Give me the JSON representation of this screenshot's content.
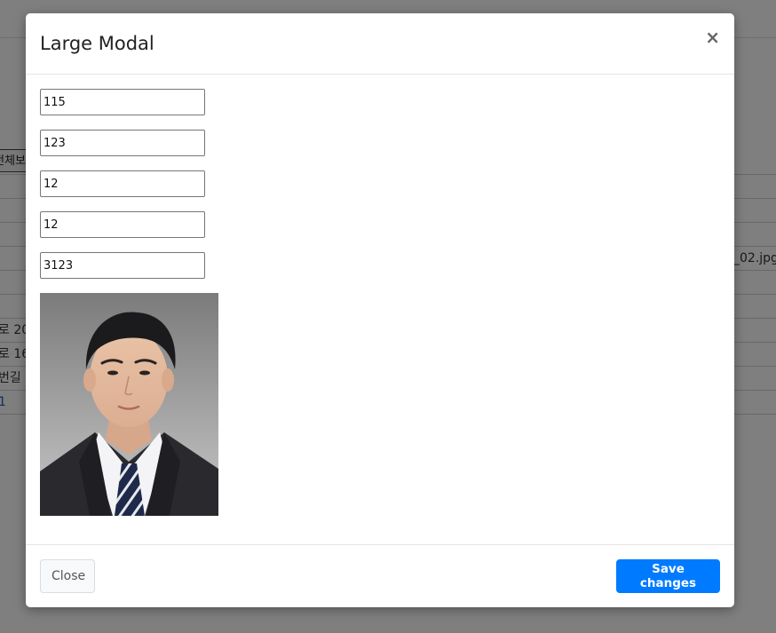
{
  "background": {
    "all_button_label": "전체보",
    "rows": [
      {
        "left": "",
        "right": ""
      },
      {
        "left": "",
        "right": ""
      },
      {
        "left": "",
        "right": ""
      },
      {
        "left": "",
        "right": "_02.jpg"
      },
      {
        "left": "",
        "right": ""
      },
      {
        "left": "",
        "right": ""
      },
      {
        "left": "로 20",
        "right": ""
      },
      {
        "left": "로 16",
        "right": ""
      },
      {
        "left": "번길",
        "right": ""
      },
      {
        "left": "1",
        "right": ""
      },
      {
        "left": "",
        "right": ""
      }
    ]
  },
  "modal": {
    "title": "Large Modal",
    "close_icon": "×",
    "fields": [
      "115",
      "123",
      "12",
      "12",
      "3123"
    ],
    "photo_name": "profile-photo",
    "footer": {
      "close_label": "Close",
      "save_label": "Save changes"
    },
    "colors": {
      "primary": "#007bff",
      "backdrop": "rgba(0,0,0,0.5)"
    }
  }
}
